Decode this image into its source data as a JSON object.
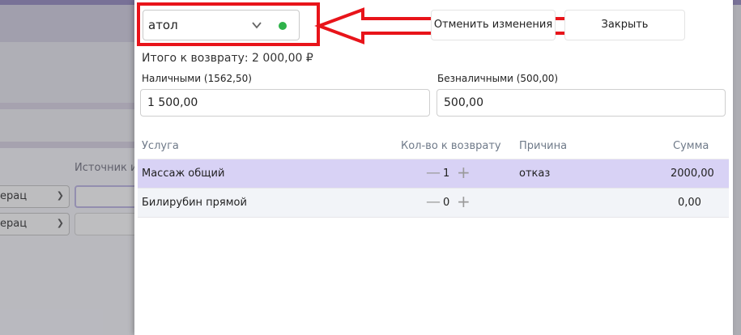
{
  "background": {
    "source_label": "Источник и",
    "rows": [
      {
        "select_text": "ерац"
      },
      {
        "select_text": "ерац"
      }
    ]
  },
  "kkm": {
    "selected": "атол",
    "status_color": "#2eb24a"
  },
  "toolbar": {
    "cancel_label": "Отменить изменения",
    "close_label": "Закрыть"
  },
  "summary": {
    "total_text": "Итого к возврату: 2 000,00 ₽"
  },
  "payment": {
    "cash_label": "Наличными (1562,50)",
    "cash_value": "1 500,00",
    "card_label": "Безналичными (500,00)",
    "card_value": "500,00"
  },
  "table": {
    "headers": {
      "service": "Услуга",
      "qty": "Кол-во к возврату",
      "reason": "Причина",
      "sum": "Сумма"
    },
    "rows": [
      {
        "service": "Массаж общий",
        "qty": "1",
        "reason": "отказ",
        "sum": "2000,00"
      },
      {
        "service": "Билирубин прямой",
        "qty": "0",
        "reason": "",
        "sum": "0,00"
      }
    ]
  },
  "colors": {
    "accent": "#8f86b8",
    "selected_row": "#d8d2f5",
    "highlight": "#e8141a"
  }
}
